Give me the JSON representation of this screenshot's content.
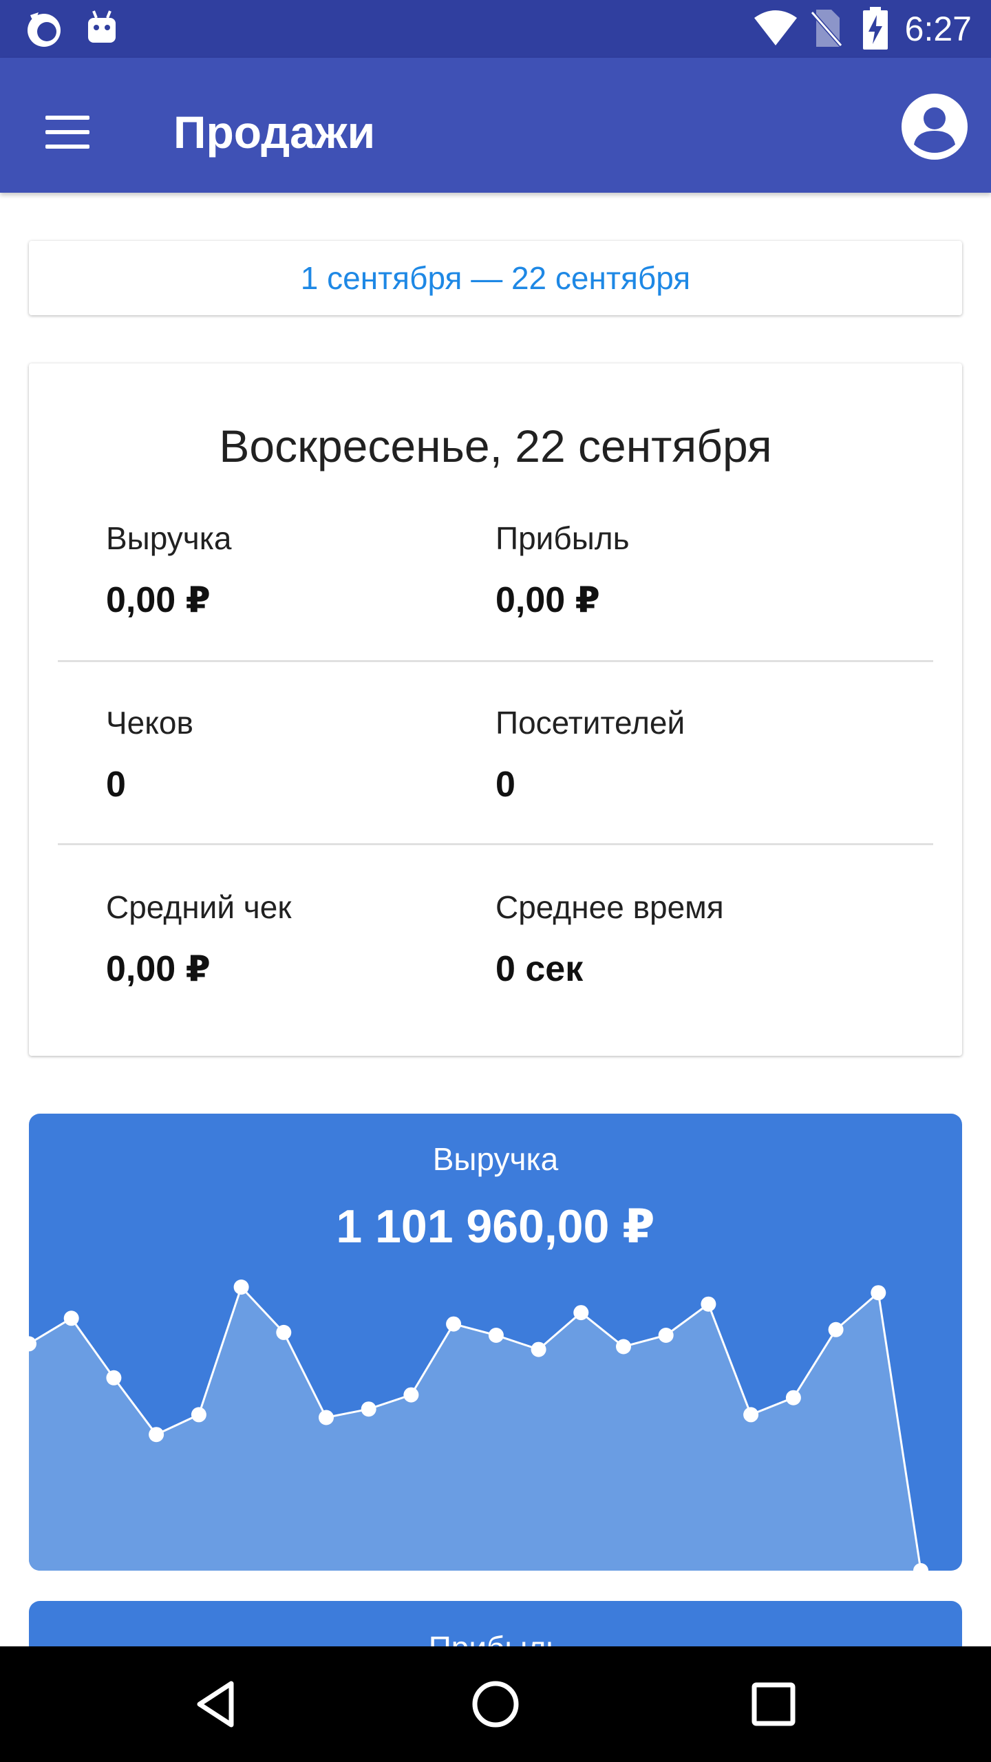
{
  "status_bar": {
    "time": "6:27",
    "icons": [
      "firefox-icon",
      "android-icon",
      "wifi-icon",
      "no-sim-icon",
      "battery-charging-icon"
    ]
  },
  "app_bar": {
    "title": "Продажи",
    "menu_icon": "menu-icon",
    "account_icon": "account-circle-icon"
  },
  "date_range": {
    "label": "1 сентября — 22 сентября",
    "color": "#1e88e5"
  },
  "day_summary": {
    "title": "Воскресенье, 22 сентября",
    "stats": [
      {
        "label": "Выручка",
        "value": "0,00 ₽"
      },
      {
        "label": "Прибыль",
        "value": "0,00 ₽"
      },
      {
        "label": "Чеков",
        "value": "0"
      },
      {
        "label": "Посетителей",
        "value": "0"
      },
      {
        "label": "Средний чек",
        "value": "0,00 ₽"
      },
      {
        "label": "Среднее время",
        "value": "0 сек"
      }
    ]
  },
  "revenue_card": {
    "label": "Выручка",
    "total": "1 101 960,00 ₽",
    "bg_color": "#3d7cdb"
  },
  "profit_card": {
    "label": "Прибыль"
  },
  "chart_data": {
    "type": "area",
    "x": [
      1,
      2,
      3,
      4,
      5,
      6,
      7,
      8,
      9,
      10,
      11,
      12,
      13,
      14,
      15,
      16,
      17,
      18,
      19,
      20,
      21,
      22
    ],
    "values": [
      80,
      89,
      68,
      48,
      55,
      100,
      84,
      54,
      57,
      62,
      87,
      83,
      78,
      91,
      79,
      83,
      94,
      55,
      61,
      85,
      98,
      0
    ],
    "values_note": "relative (0–100) — axis not shown",
    "ylim": [
      0,
      100
    ],
    "grid": false,
    "fill_color": "#6a9de3",
    "line_color": "#ffffff"
  },
  "nav_bar": {
    "icons": [
      "back-icon",
      "home-icon",
      "recents-icon"
    ]
  }
}
